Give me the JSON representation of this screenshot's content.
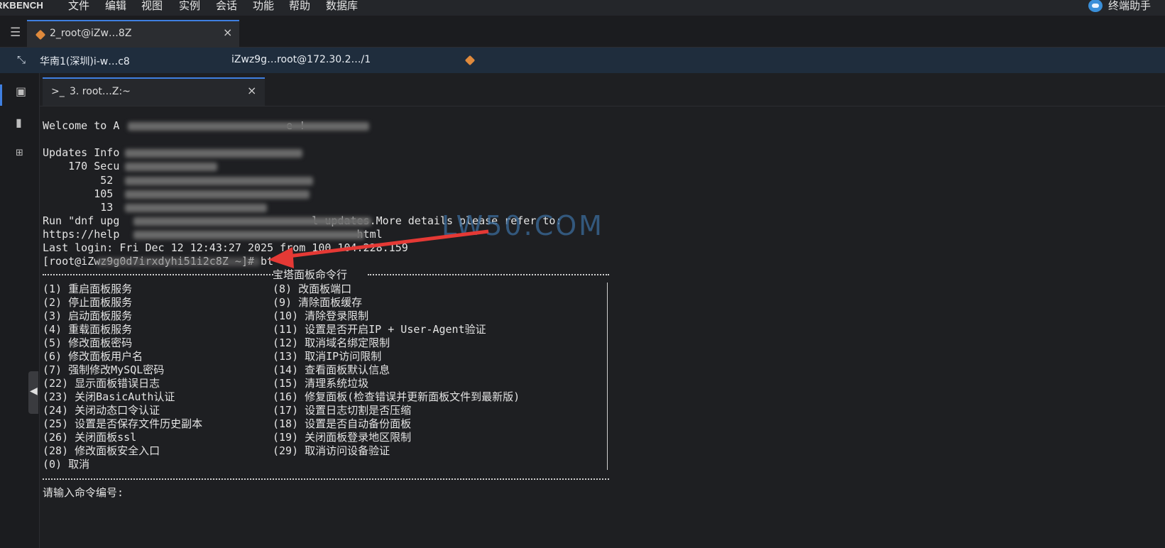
{
  "menubar": {
    "brand": "RKBENCH",
    "items": [
      "文件",
      "编辑",
      "视图",
      "实例",
      "会话",
      "功能",
      "帮助",
      "数据库"
    ],
    "assistant_label": "终端助手"
  },
  "session_tab": {
    "title": "2_root@iZw…8Z",
    "close": "×"
  },
  "infobar": {
    "region": "华南1(深圳)i-w…c8",
    "host": "iZwz9g…root@172.30.2…/1"
  },
  "terminal_tab": {
    "icon": ">_",
    "title": "3. root…Z:~",
    "close": "×"
  },
  "terminal": {
    "welcome": "Welcome to A                          e !",
    "updates": "Updates Info",
    "sec_count": "    170 Secu",
    "c52": "         52",
    "c105": "        105",
    "c13": "         13",
    "run_line": "Run \"dnf upg                              l updates.More details please refer to:",
    "https_line": "https://help                                     html",
    "last_login": "Last login: Fri Dec 12 12:43:27 2025 from 100.104.228.159",
    "prompt": "[root@iZwz9g0d7irxdyhi51i2c8Z ~]# bt",
    "menu_title": "宝塔面板命令行",
    "left_options": [
      "(1) 重启面板服务",
      "(2) 停止面板服务",
      "(3) 启动面板服务",
      "(4) 重载面板服务",
      "(5) 修改面板密码",
      "(6) 修改面板用户名",
      "(7) 强制修改MySQL密码",
      "(22) 显示面板错误日志",
      "(23) 关闭BasicAuth认证",
      "(24) 关闭动态口令认证",
      "(25) 设置是否保存文件历史副本",
      "(26) 关闭面板ssl",
      "(28) 修改面板安全入口",
      "(0) 取消"
    ],
    "right_options": [
      "(8) 改面板端口",
      "(9) 清除面板缓存",
      "(10) 清除登录限制",
      "(11) 设置是否开启IP + User-Agent验证",
      "(12) 取消域名绑定限制",
      "(13) 取消IP访问限制",
      "(14) 查看面板默认信息",
      "(15) 清理系统垃圾",
      "(16) 修复面板(检查错误并更新面板文件到最新版)",
      "(17) 设置日志切割是否压缩",
      "(18) 设置是否自动备份面板",
      "(19) 关闭面板登录地区限制",
      "(29) 取消访问设备验证"
    ],
    "input_prompt": "请输入命令编号:"
  },
  "watermark": "LW50.COM",
  "colors": {
    "accent": "#3f7fe0",
    "arrow": "#e53935",
    "watermark": "#3a6c9c"
  }
}
